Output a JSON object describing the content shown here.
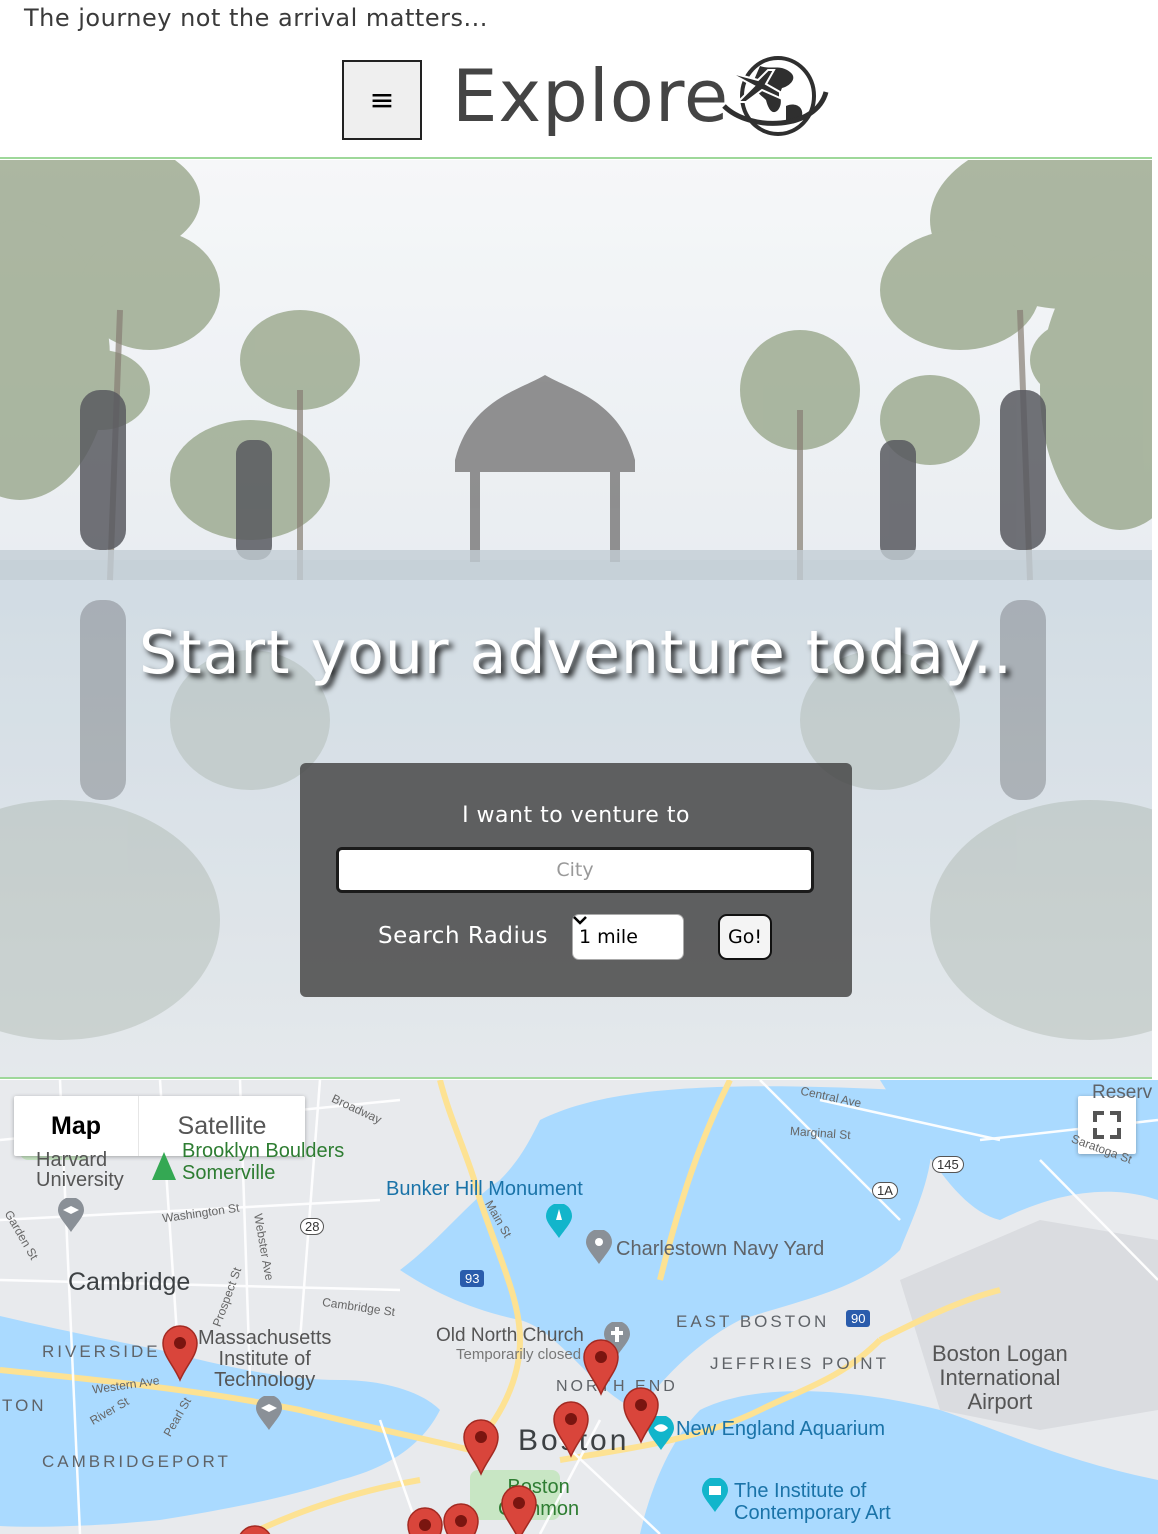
{
  "header": {
    "tagline": "The journey not the arrival matters...",
    "menu_icon": "≡",
    "brand": "Explore",
    "logo_icon": "globe-airplane-icon"
  },
  "hero": {
    "title": "Start your adventure today..",
    "search": {
      "label": "I want to venture to",
      "city_placeholder": "City",
      "city_value": "",
      "radius_label": "Search Radius",
      "radius_selected": "1 mile",
      "go_label": "Go!"
    }
  },
  "map": {
    "type_map": "Map",
    "type_satellite": "Satellite",
    "labels": {
      "harvard": "Harvard\nUniversity",
      "brooklyn": "Brooklyn Boulders\nSomerville",
      "bunker": "Bunker Hill Monument",
      "charlestown": "Charlestown Navy Yard",
      "cambridge": "Cambridge",
      "mit": "Massachusetts\nInstitute of\nTechnology",
      "oldnorth": "Old North Church",
      "oldnorth_sub": "Temporarily closed",
      "eastboston": "EAST BOSTON",
      "jeffries": "JEFFRIES POINT",
      "logan": "Boston Logan\nInternational\nAirport",
      "northend": "NORTH END",
      "boston": "Boston",
      "aquarium": "New England Aquarium",
      "common": "Boston\nCommon",
      "ica": "The Institute of\nContemporary Art",
      "riverside": "RIVERSIDE",
      "cambridgeport": "CAMBRIDGEPORT",
      "ton": "TON",
      "reserve": "Reserv",
      "central": "Central Ave",
      "marginal": "Marginal St",
      "broadway": "Broadway",
      "washington": "Washington St",
      "cambridge_st": "Cambridge St",
      "western": "Western Ave",
      "river_st": "River St",
      "pearl": "Pearl St",
      "main_st": "Main St",
      "webster": "Webster Ave",
      "prospect": "Prospect St",
      "garden": "Garden St",
      "saratoga": "Saratoga St",
      "route28": "28",
      "route93": "93",
      "route145": "145",
      "route1a": "1A",
      "route90": "90"
    },
    "icons": {
      "fullscreen": "fullscreen-icon",
      "marker": "map-marker-icon"
    }
  },
  "colors": {
    "accent_green": "#9ed89a",
    "search_panel": "#484848",
    "marker_red": "#d9453b",
    "water": "#aadaff"
  }
}
